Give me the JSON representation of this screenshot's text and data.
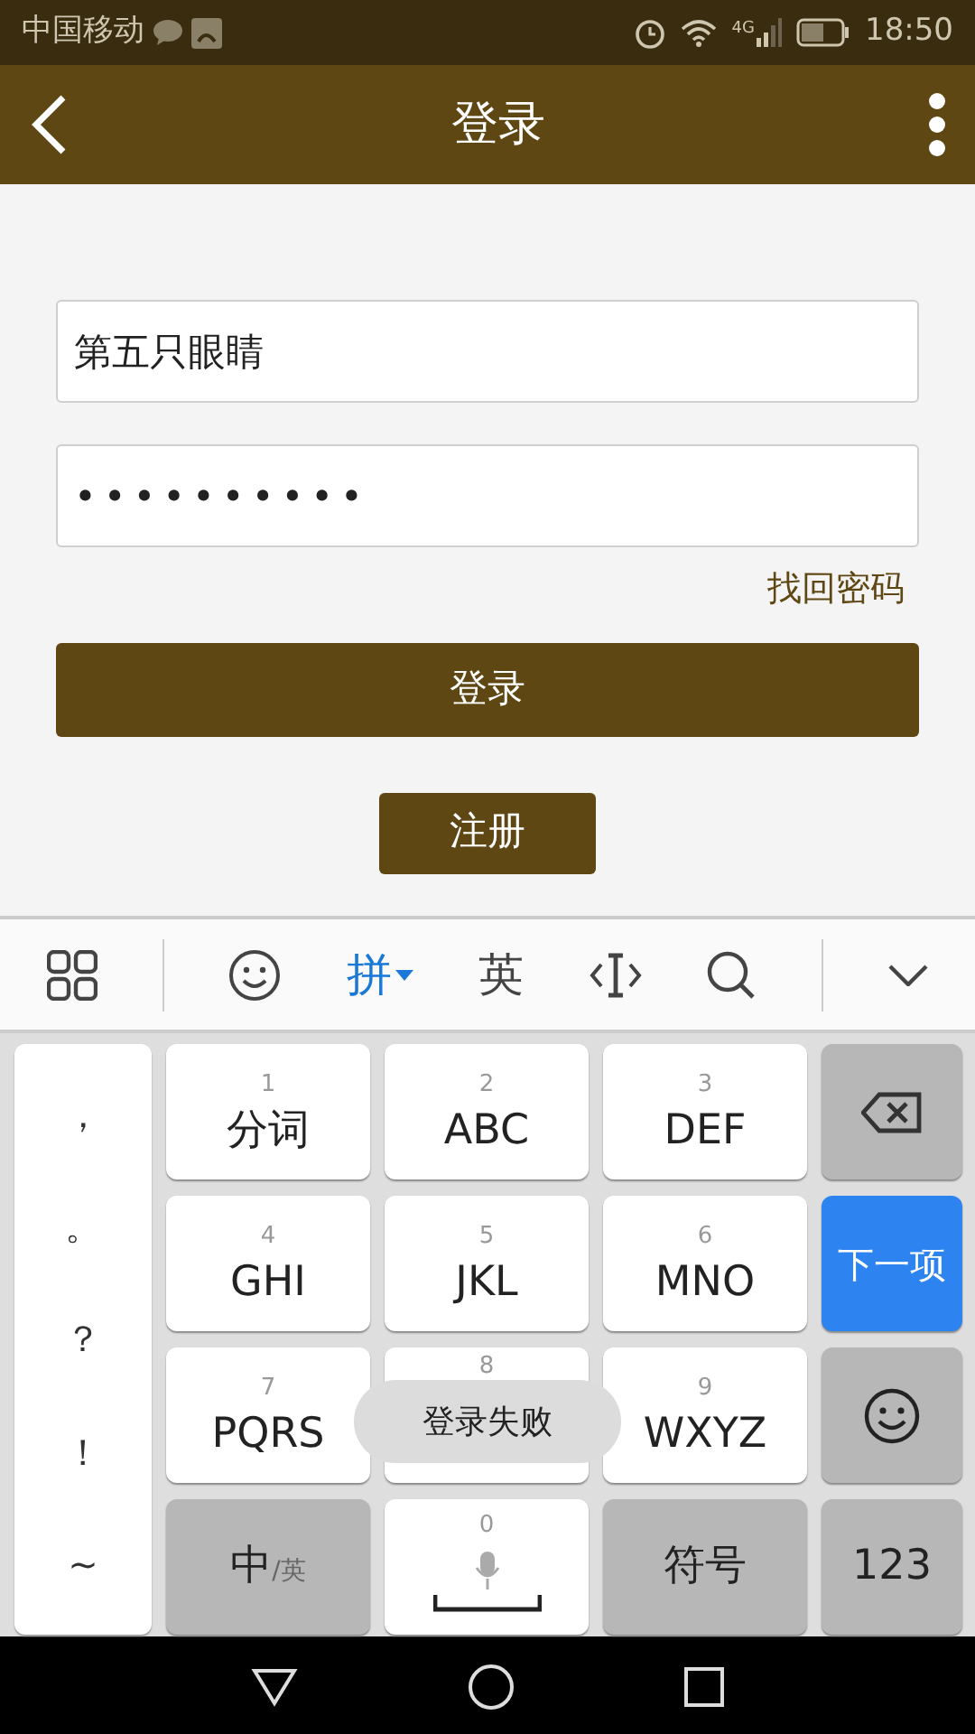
{
  "status_bar": {
    "carrier": "中国移动",
    "network": "4G",
    "time": "18:50"
  },
  "header": {
    "title": "登录"
  },
  "form": {
    "username": "第五只眼睛",
    "password": "••••••••••",
    "forgot_link": "找回密码",
    "login_button": "登录",
    "register_button": "注册"
  },
  "keyboard_toolbar": [
    {
      "kind": "grid"
    },
    {
      "kind": "divider"
    },
    {
      "kind": "emoji"
    },
    {
      "kind": "text",
      "label": "拼",
      "selected": true
    },
    {
      "kind": "text",
      "label": "英",
      "selected": false
    },
    {
      "kind": "cursor"
    },
    {
      "kind": "search"
    },
    {
      "kind": "divider"
    },
    {
      "kind": "collapse"
    }
  ],
  "keyboard": {
    "punctuation": [
      "，",
      "。",
      "？",
      "！",
      "~"
    ],
    "keys": [
      {
        "kind": "letter",
        "digit": "1",
        "label": "分词"
      },
      {
        "kind": "letter",
        "digit": "2",
        "label": "ABC"
      },
      {
        "kind": "letter",
        "digit": "3",
        "label": "DEF"
      },
      {
        "kind": "backspace"
      },
      {
        "kind": "letter",
        "digit": "4",
        "label": "GHI"
      },
      {
        "kind": "letter",
        "digit": "5",
        "label": "JKL"
      },
      {
        "kind": "letter",
        "digit": "6",
        "label": "MNO"
      },
      {
        "kind": "action",
        "label": "下一项"
      },
      {
        "kind": "letter",
        "digit": "7",
        "label": "PQRS"
      },
      {
        "kind": "letter",
        "digit": "8"
      },
      {
        "kind": "letter",
        "digit": "9",
        "label": "WXYZ"
      },
      {
        "kind": "emoji"
      },
      {
        "kind": "lang",
        "label": "中",
        "sub": "/英"
      },
      {
        "kind": "space",
        "digit": "0"
      },
      {
        "kind": "function",
        "label": "符号"
      },
      {
        "kind": "function",
        "label": "123"
      }
    ]
  },
  "toast": "登录失败"
}
